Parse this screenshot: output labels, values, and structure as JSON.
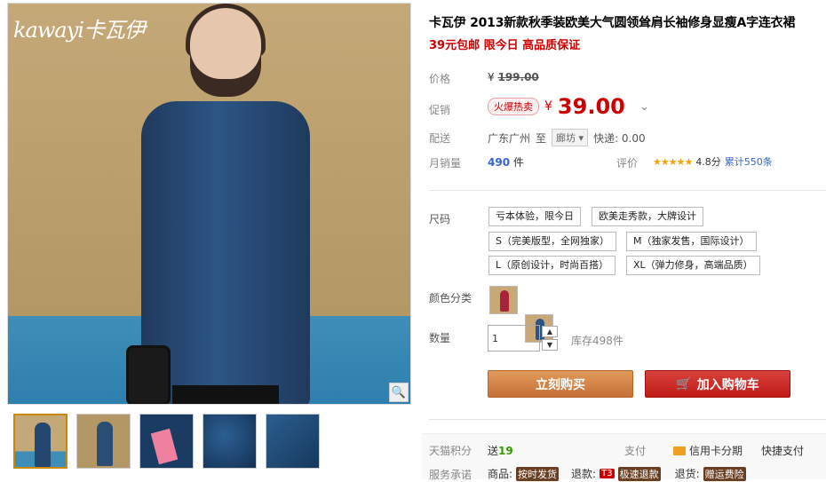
{
  "product": {
    "title": "卡瓦伊 2013新款秋季装欧美大气圆领耸肩长袖修身显瘦A字连衣裙",
    "subtitle": "39元包邮 限今日 高品质保证",
    "logo_text": "kawayi卡瓦伊"
  },
  "price": {
    "label": "价格",
    "currency": "¥",
    "original": "199.00"
  },
  "promo": {
    "label": "促销",
    "badge": "火爆热卖",
    "currency": "¥",
    "price": "39.00",
    "chevron": "⌄"
  },
  "shipping": {
    "label": "配送",
    "origin": "广东广州",
    "to": "至",
    "destination": "廊坊",
    "fee_text": "快递: 0.00"
  },
  "sales": {
    "label": "月销量",
    "count": "490",
    "unit": "件",
    "rating_label": "评价",
    "stars": "★★★★★",
    "score": "4.8分",
    "reviews": "累计550条"
  },
  "size": {
    "label": "尺码",
    "options": [
      "亏本体验，限今日",
      "欧美走秀款，大牌设计",
      "S（完美版型，全网独家）",
      "M（独家发售，国际设计）",
      "L（原创设计，时尚百搭）",
      "XL（弹力修身，高端品质）"
    ]
  },
  "color": {
    "label": "颜色分类"
  },
  "quantity": {
    "label": "数量",
    "value": "1",
    "stock": "库存498件",
    "up": "▲",
    "down": "▼"
  },
  "buttons": {
    "buy": "立刻购买",
    "cart": "加入购物车"
  },
  "bottom": {
    "points_label": "天猫积分",
    "points_prefix": "送",
    "points_value": "19",
    "pay_label": "支付",
    "credit": "信用卡分期",
    "fast_pay": "快捷支付",
    "service_label": "服务承诺",
    "goods_label": "商品:",
    "goods_badge": "按时发货",
    "refund_label": "退款:",
    "refund_tag": "T3",
    "refund_badge": "极速退款",
    "return_label": "退货:",
    "return_badge": "赠运费险"
  },
  "colors": {
    "price_red": "#cc0000",
    "buy_orange": "#c57034",
    "cart_red": "#c01b17",
    "dress_blue": "#2c5585",
    "swatch_red": "#a8223a"
  }
}
